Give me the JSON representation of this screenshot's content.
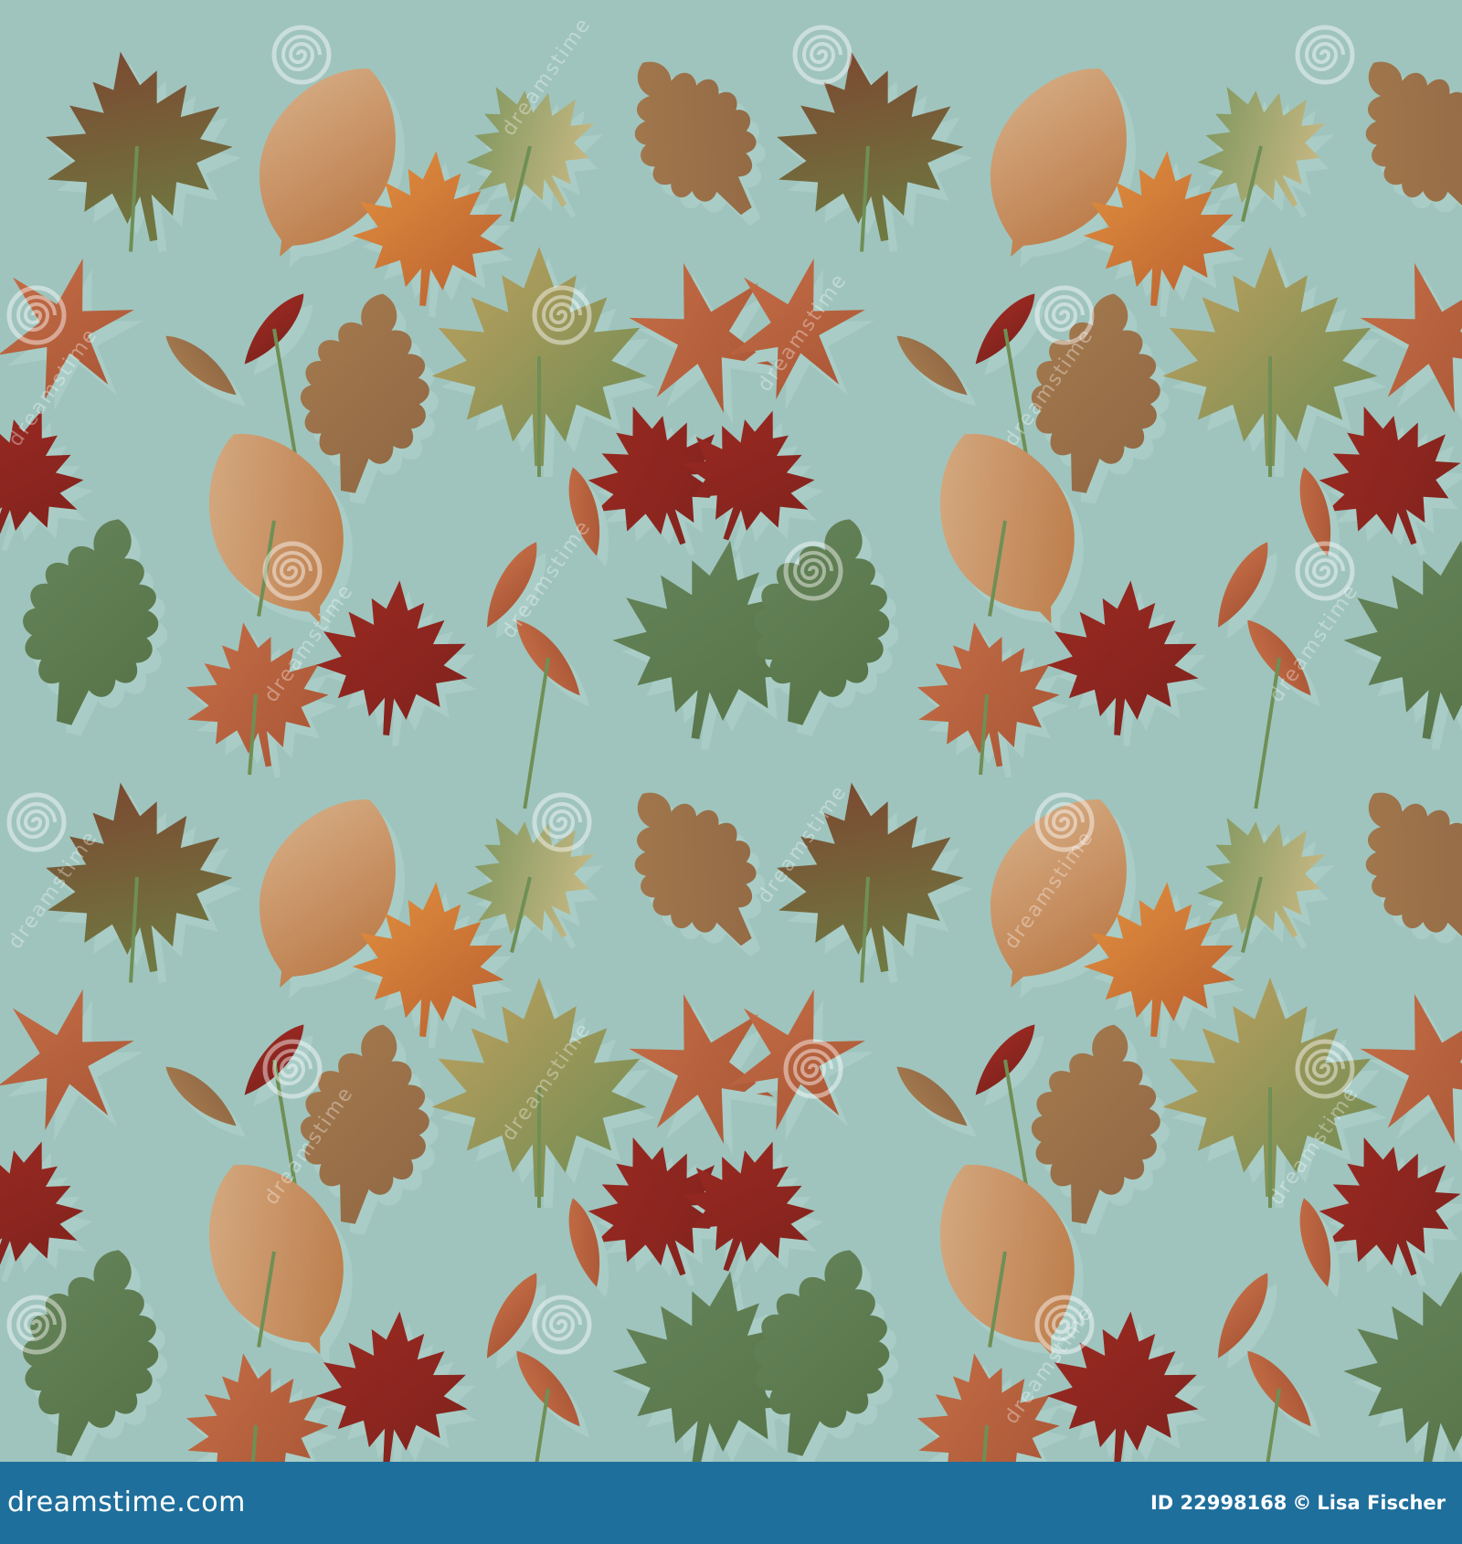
{
  "scene": {
    "description_type": "seamless autumn leaf pattern",
    "background_color": "#9fc4bd",
    "shadow_color": "#a9cdc6",
    "leaf_colors": {
      "red": "#8e2620",
      "rust": "#b8613d",
      "green": "#5d7b4d",
      "brown": "#a0734c",
      "tan": "#c89c72",
      "orange": "#d9833f",
      "olive": "#8a8a4e"
    }
  },
  "watermark": {
    "text": "dreamstime",
    "icon": "spiral-icon"
  },
  "footer": {
    "background": "#1f6f9c",
    "logo_text": "dreamstime.com",
    "id_label": "ID 22998168",
    "copyright_symbol": "©",
    "author": "Lisa Fischer"
  }
}
